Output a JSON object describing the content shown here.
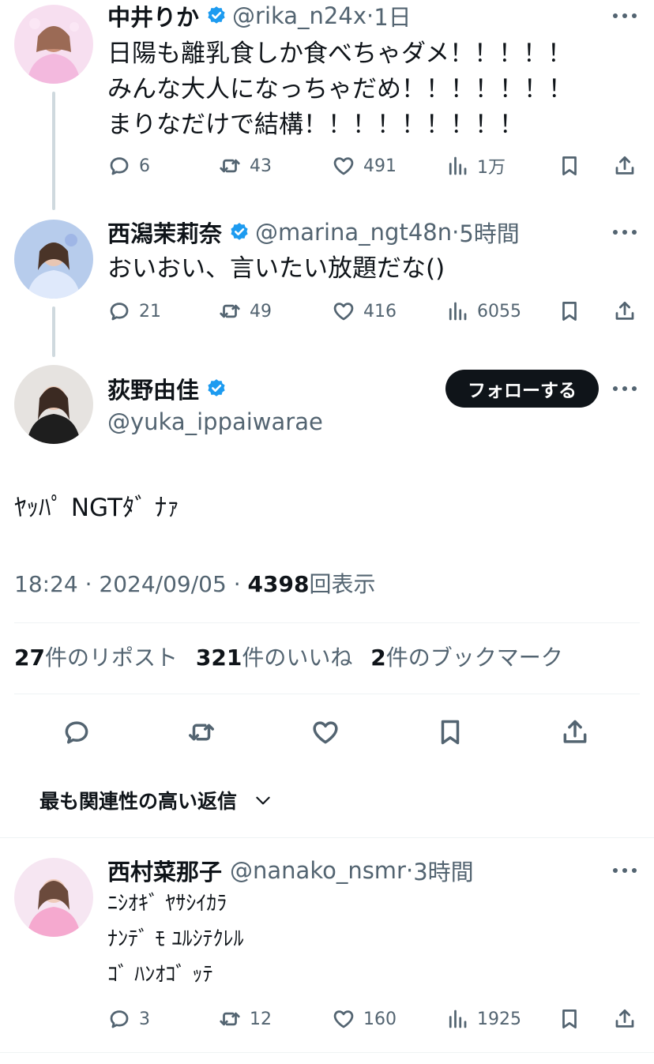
{
  "tweets": [
    {
      "name": "中井りか",
      "handle": "@rika_n24x",
      "sep": "·",
      "time": "1日",
      "lines": [
        "日陽も離乳食しか食べちゃダメ！！！！！",
        "みんな大人になっちゃだめ！！！！！！！",
        "まりなだけで結構！！！！！！！！！"
      ],
      "replies": "6",
      "reposts": "43",
      "likes": "491",
      "views": "1万"
    },
    {
      "name": "西潟茉莉奈",
      "handle": "@marina_ngt48n",
      "sep": "·",
      "time": "5時間",
      "lines": [
        "おいおい、言いたい放題だな()"
      ],
      "replies": "21",
      "reposts": "49",
      "likes": "416",
      "views": "6055"
    }
  ],
  "main": {
    "name": "荻野由佳",
    "handle": "@yuka_ippaiwarae",
    "follow_label": "フォローする",
    "text": "ﾔｯﾊﾟ NGTﾀﾞ ﾅｧ",
    "time": "18:24",
    "date": "2024/09/05",
    "sep": "·",
    "views_num": "4398",
    "views_label": "回表示",
    "reposts_num": "27",
    "reposts_label": "件のリポスト",
    "likes_num": "321",
    "likes_label": "件のいいね",
    "bookmarks_num": "2",
    "bookmarks_label": "件のブックマーク"
  },
  "sort": {
    "label": "最も関連性の高い返信"
  },
  "reply": {
    "name": "西村菜那子",
    "handle": "@nanako_nsmr",
    "sep": "·",
    "time": "3時間",
    "lines": [
      "ﾆｼｵｷﾞ ﾔｻｼｲｶﾗ",
      "ﾅﾝﾃﾞ ﾓ ﾕﾙｼﾃｸﾚﾙ",
      "ｺﾞ ﾊﾝｵｺﾞ ｯﾃ"
    ],
    "replies": "3",
    "reposts": "12",
    "likes": "160",
    "views": "1925"
  },
  "colors": {
    "text": "#0f1419",
    "secondary": "#536471",
    "verified": "#1d9bf0",
    "divider": "#eff3f4",
    "thread_line": "#cfd9de",
    "button": "#0f1419"
  },
  "icons": [
    "verified-badge-icon",
    "more-icon",
    "reply-icon",
    "repost-icon",
    "like-icon",
    "views-icon",
    "bookmark-icon",
    "share-icon",
    "chevron-down-icon"
  ]
}
